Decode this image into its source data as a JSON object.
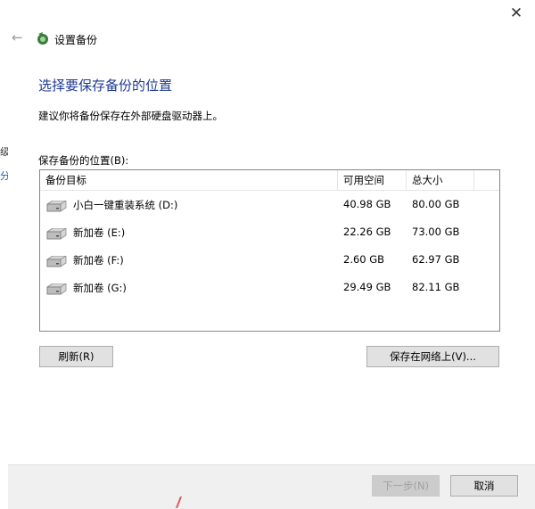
{
  "window": {
    "title": "设置备份",
    "close_symbol": "✕",
    "back_symbol": "←"
  },
  "background": {
    "snippet_1": "级",
    "snippet_2": "分"
  },
  "page": {
    "heading": "选择要保存备份的位置",
    "description": "建议你将备份保存在外部硬盘驱动器上。",
    "location_label": "保存备份的位置(B):"
  },
  "table": {
    "columns": [
      "备份目标",
      "可用空间",
      "总大小"
    ],
    "rows": [
      {
        "name": "小白一键重装系统 (D:)",
        "free": "40.98 GB",
        "total": "80.00 GB"
      },
      {
        "name": "新加卷 (E:)",
        "free": "22.26 GB",
        "total": "73.00 GB"
      },
      {
        "name": "新加卷 (F:)",
        "free": "2.60 GB",
        "total": "62.97 GB"
      },
      {
        "name": "新加卷 (G:)",
        "free": "29.49 GB",
        "total": "82.11 GB"
      }
    ]
  },
  "buttons": {
    "refresh": "刷新(R)",
    "save_network": "保存在网络上(V)...",
    "next": "下一步(N)",
    "cancel": "取消"
  },
  "icons": {
    "title_icon": "backup-icon",
    "drive_icon": "hard-drive-icon"
  },
  "colors": {
    "heading": "#1f3a93",
    "footer_bg": "#f0f0f0",
    "button_bg": "#e1e1e1"
  }
}
